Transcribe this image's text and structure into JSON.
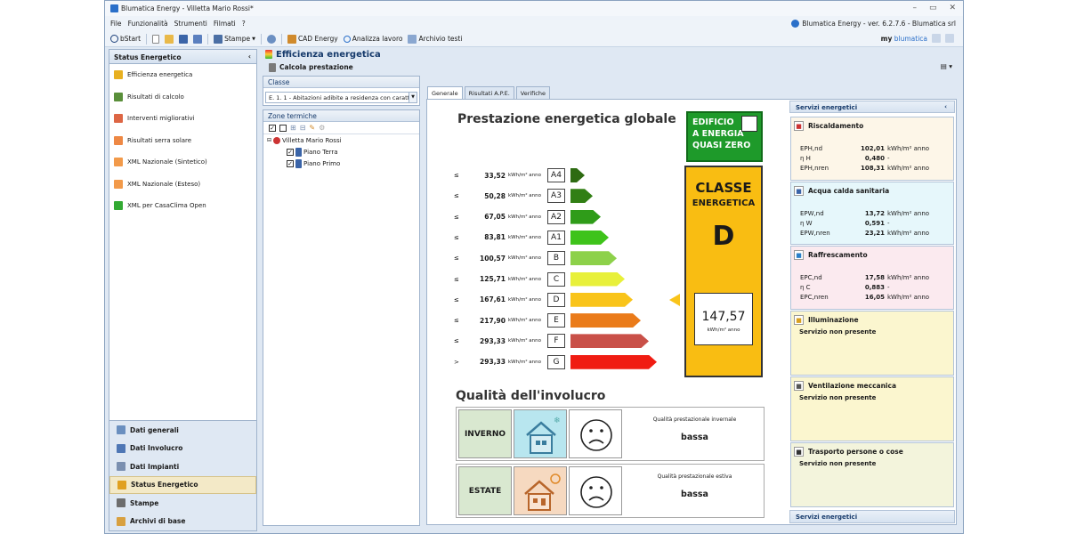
{
  "window": {
    "title": "Blumatica Energy - Villetta Mario Rossi*"
  },
  "menu": {
    "items": [
      "File",
      "Funzionalità",
      "Strumenti",
      "Filmati",
      "?"
    ],
    "version": "Blumatica Energy - ver. 6.2.7.6 - Blumatica srl"
  },
  "toolbar": {
    "bstart": "bStart",
    "stampe": "Stampe",
    "cad": "CAD Energy",
    "analizza": "Analizza lavoro",
    "archivio": "Archivio testi",
    "my_prefix": "my",
    "my_brand": "blumatica"
  },
  "sidebar": {
    "title": "Status Energetico",
    "items": [
      {
        "label": "Efficienza energetica",
        "icon": "energy-bars-icon"
      },
      {
        "label": "Risultati di calcolo",
        "icon": "calculator-icon"
      },
      {
        "label": "Interventi migliorativi",
        "icon": "improvements-icon"
      },
      {
        "label": "Risultati serra solare",
        "icon": "greenhouse-icon"
      },
      {
        "label": "XML Nazionale (Sintetico)",
        "icon": "xml-icon"
      },
      {
        "label": "XML Nazionale (Esteso)",
        "icon": "xml-icon"
      },
      {
        "label": "XML per CasaClima Open",
        "icon": "casaclima-icon"
      }
    ],
    "nav": [
      "Dati generali",
      "Dati Involucro",
      "Dati Impianti",
      "Status Energetico",
      "Stampe",
      "Archivi di base"
    ]
  },
  "main": {
    "title": "Efficienza energetica",
    "subtitle": "Calcola prestazione"
  },
  "classe": {
    "header": "Classe",
    "value": "E. 1. 1 - Abitazioni adibite a residenza con carattere ..."
  },
  "zone": {
    "header": "Zone termiche",
    "root": "Villetta Mario Rossi",
    "children": [
      "Piano Terra",
      "Piano Primo"
    ]
  },
  "tabs": [
    "Generale",
    "Risultati A.P.E.",
    "Verifiche"
  ],
  "ape": {
    "title": "Prestazione energetica globale",
    "unit": "kWh/m² anno",
    "nzeb": [
      "EDIFICIO",
      "A ENERGIA",
      "QUASI ZERO"
    ],
    "class_label": [
      "CLASSE",
      "ENERGETICA"
    ],
    "class_value": "D",
    "ep_value": "147,57",
    "ep_unit": "kWh/m² anno",
    "rows": [
      {
        "op": "≤",
        "val": "33,52",
        "cls": "A4",
        "color": "#2e6b12"
      },
      {
        "op": "≤",
        "val": "50,28",
        "cls": "A3",
        "color": "#317f14"
      },
      {
        "op": "≤",
        "val": "67,05",
        "cls": "A2",
        "color": "#2f9c19"
      },
      {
        "op": "≤",
        "val": "83,81",
        "cls": "A1",
        "color": "#3ec31a"
      },
      {
        "op": "≤",
        "val": "100,57",
        "cls": "B",
        "color": "#8dd14a"
      },
      {
        "op": "≤",
        "val": "125,71",
        "cls": "C",
        "color": "#e8f03a"
      },
      {
        "op": "≤",
        "val": "167,61",
        "cls": "D",
        "color": "#f9c41a"
      },
      {
        "op": "≤",
        "val": "217,90",
        "cls": "E",
        "color": "#ea7b1a"
      },
      {
        "op": "≤",
        "val": "293,33",
        "cls": "F",
        "color": "#c95048"
      },
      {
        "op": ">",
        "val": "293,33",
        "cls": "G",
        "color": "#f01c12"
      }
    ],
    "quality_title": "Qualità dell'involucro",
    "winter": {
      "label": "INVERNO",
      "caption": "Qualità prestazionale invernale",
      "value": "bassa"
    },
    "summer": {
      "label": "ESTATE",
      "caption": "Qualità prestazionale estiva",
      "value": "bassa"
    }
  },
  "services": {
    "header": "Servizi energetici",
    "footer": "Servizi energetici",
    "cards": [
      {
        "title": "Riscaldamento",
        "bg": "#fdf6e8",
        "rows": [
          [
            "EPH,nd",
            "102,01",
            "kWh/m² anno"
          ],
          [
            "η H",
            "0,480",
            "-"
          ],
          [
            "EPH,nren",
            "108,31",
            "kWh/m² anno"
          ]
        ]
      },
      {
        "title": "Acqua calda sanitaria",
        "bg": "#e6f7fb",
        "rows": [
          [
            "EPW,nd",
            "13,72",
            "kWh/m² anno"
          ],
          [
            "η W",
            "0,591",
            "-"
          ],
          [
            "EPW,nren",
            "23,21",
            "kWh/m² anno"
          ]
        ]
      },
      {
        "title": "Raffrescamento",
        "bg": "#fbeaef",
        "rows": [
          [
            "EPC,nd",
            "17,58",
            "kWh/m² anno"
          ],
          [
            "η C",
            "0,883",
            "-"
          ],
          [
            "EPC,nren",
            "16,05",
            "kWh/m² anno"
          ]
        ]
      },
      {
        "title": "Illuminazione",
        "bg": "#fbf6cf",
        "note": "Servizio non presente"
      },
      {
        "title": "Ventilazione meccanica",
        "bg": "#fbf6cf",
        "note": "Servizio non presente"
      },
      {
        "title": "Trasporto persone o cose",
        "bg": "#f3f4dc",
        "note": "Servizio non presente"
      }
    ]
  }
}
